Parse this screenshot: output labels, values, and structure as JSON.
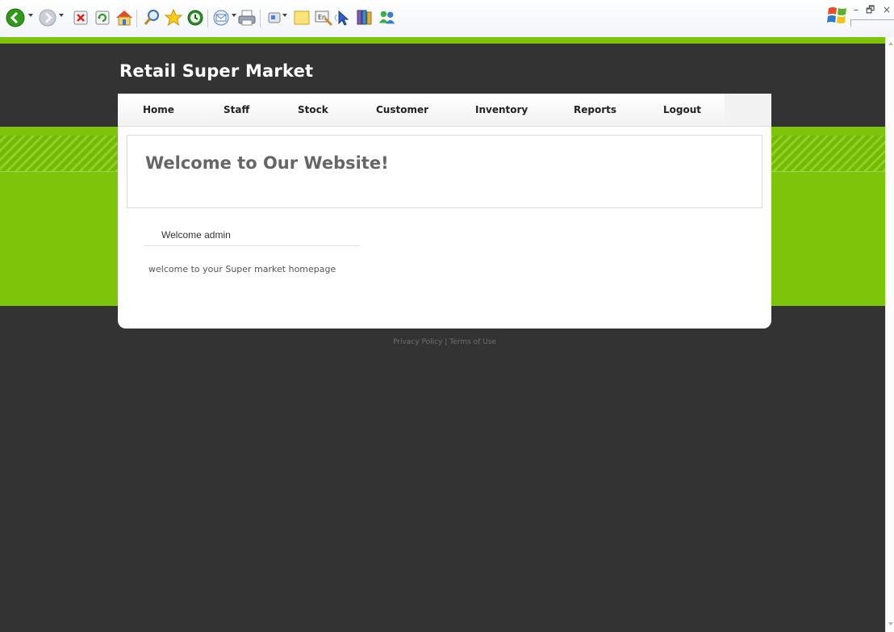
{
  "site": {
    "title": "Retail Super Market"
  },
  "nav": {
    "items": [
      {
        "label": "Home"
      },
      {
        "label": "Staff"
      },
      {
        "label": "Stock"
      },
      {
        "label": "Customer"
      },
      {
        "label": "Inventory"
      },
      {
        "label": "Reports"
      },
      {
        "label": "Logout"
      }
    ]
  },
  "main": {
    "heading": "Welcome to Our Website!",
    "user_greeting": "Welcome admin",
    "message": "welcome to your Super market homepage"
  },
  "footer": {
    "privacy": "Privacy Policy",
    "separator": "|",
    "terms": "Terms of Use"
  },
  "window": {
    "minimize": "–",
    "restore": "🗗",
    "close": "×"
  },
  "toolbar": {
    "icons": [
      "back-icon",
      "forward-icon",
      "stop-icon",
      "refresh-icon",
      "home-icon",
      "search-icon",
      "favorites-icon",
      "history-icon",
      "mail-icon",
      "print-icon",
      "edit-icon",
      "note-icon",
      "translate-icon",
      "cursor-icon",
      "research-icon",
      "messenger-icon"
    ]
  },
  "colors": {
    "accent_green": "#7dc40a",
    "page_dark": "#333333",
    "heading_gray": "#666666"
  }
}
